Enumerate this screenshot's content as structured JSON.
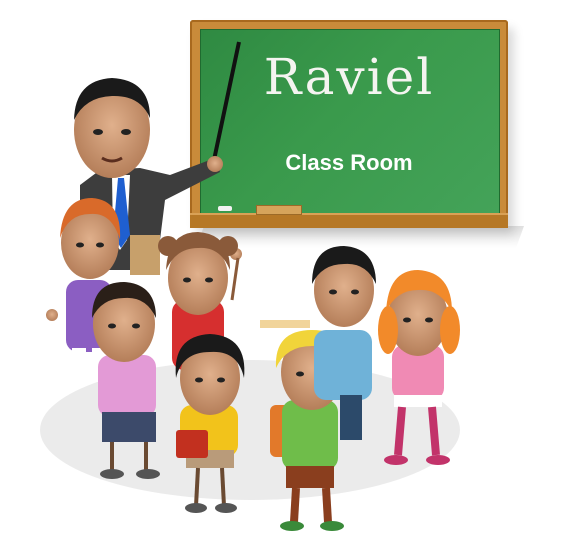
{
  "board": {
    "title": "Raviel",
    "subtitle": "Class Room"
  },
  "colors": {
    "board_green": "#3a9a4c",
    "board_frame": "#c98b3a",
    "chalk": "#f4f4f0"
  },
  "figures": [
    {
      "role": "teacher",
      "icon": "teacher-figure"
    },
    {
      "role": "student",
      "icon": "student-orange-hair"
    },
    {
      "role": "student",
      "icon": "student-pigtails"
    },
    {
      "role": "student",
      "icon": "student-pink-shirt"
    },
    {
      "role": "student",
      "icon": "student-yellow-shirt"
    },
    {
      "role": "student",
      "icon": "student-blond-boy"
    },
    {
      "role": "student",
      "icon": "student-blue-shirt"
    },
    {
      "role": "student",
      "icon": "student-orange-pigtails"
    }
  ]
}
